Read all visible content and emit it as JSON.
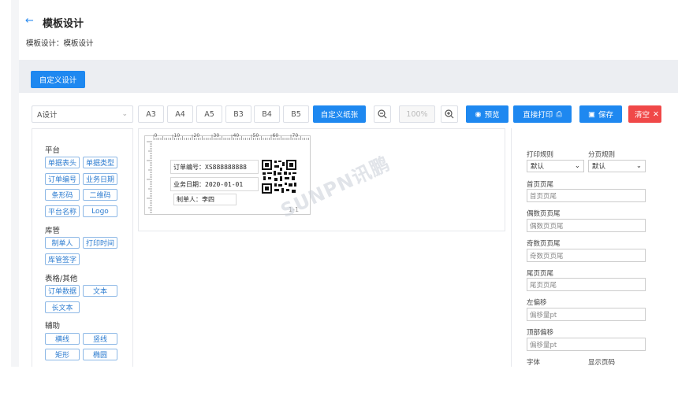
{
  "header": {
    "title": "模板设计",
    "breadcrumb": "模板设计：模板设计"
  },
  "custom_design_button": "自定义设计",
  "toolbar": {
    "template_select": "A设计",
    "paper_sizes": [
      "A3",
      "A4",
      "A5",
      "B3",
      "B4",
      "B5"
    ],
    "custom_paper": "自定义纸张",
    "zoom": "100%",
    "preview": "预览",
    "direct_print": "直接打印",
    "save": "保存",
    "clear": "清空"
  },
  "sidebar": {
    "groups": [
      {
        "title": "平台",
        "items": [
          "单据表头",
          "单据类型",
          "订单编号",
          "业务日期",
          "条形码",
          "二维码",
          "平台名称",
          "Logo"
        ]
      },
      {
        "title": "库管",
        "items": [
          "制单人",
          "打印时间",
          "库管签字"
        ]
      },
      {
        "title": "表格/其他",
        "items": [
          "订单数据",
          "文本",
          "长文本"
        ]
      },
      {
        "title": "辅助",
        "items": [
          "横线",
          "竖线",
          "矩形",
          "椭圆"
        ]
      }
    ]
  },
  "canvas": {
    "ruler_labels": [
      "0",
      "10",
      "20",
      "30",
      "40",
      "50",
      "60",
      "70"
    ],
    "fields": {
      "order_no": "订单编号：XS888888888",
      "biz_date": "业务日期：2020-01-01",
      "maker": "制单人：李四"
    },
    "page_indicator": "1-1",
    "watermark": "SUNPN讯鹏"
  },
  "properties": {
    "print_rule_label": "打印规则",
    "print_rule_value": "默认",
    "page_rule_label": "分页规则",
    "page_rule_value": "默认",
    "fields": [
      {
        "label": "首页页尾",
        "placeholder": "首页页尾"
      },
      {
        "label": "偶数页页尾",
        "placeholder": "偶数页页尾"
      },
      {
        "label": "奇数页页尾",
        "placeholder": "奇数页页尾"
      },
      {
        "label": "尾页页尾",
        "placeholder": "尾页页尾"
      },
      {
        "label": "左偏移",
        "placeholder": "偏移量pt"
      },
      {
        "label": "顶部偏移",
        "placeholder": "偏移量pt"
      }
    ],
    "font_label": "字体",
    "show_page_label": "显示页码"
  }
}
